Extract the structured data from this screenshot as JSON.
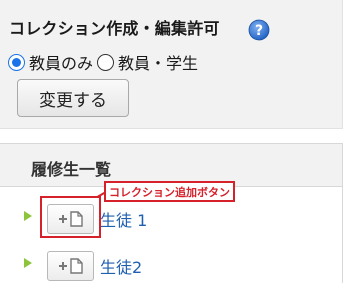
{
  "permission": {
    "title": "コレクション作成・編集許可",
    "help_icon": "question-help-icon",
    "options": [
      {
        "label": "教員のみ",
        "selected": true
      },
      {
        "label": "教員・学生",
        "selected": false
      }
    ],
    "change_button": "変更する"
  },
  "students": {
    "header": "履修生一覧",
    "add_button_icon": "add-document-icon",
    "rows": [
      {
        "name": "生徒 1"
      },
      {
        "name": "生徒2"
      }
    ]
  },
  "annotation": {
    "label": "コレクション追加ボタン",
    "color": "#d6202a"
  },
  "colors": {
    "accent": "#1a73e8",
    "link": "#1f5fb0",
    "arrow": "#8cc43c"
  }
}
